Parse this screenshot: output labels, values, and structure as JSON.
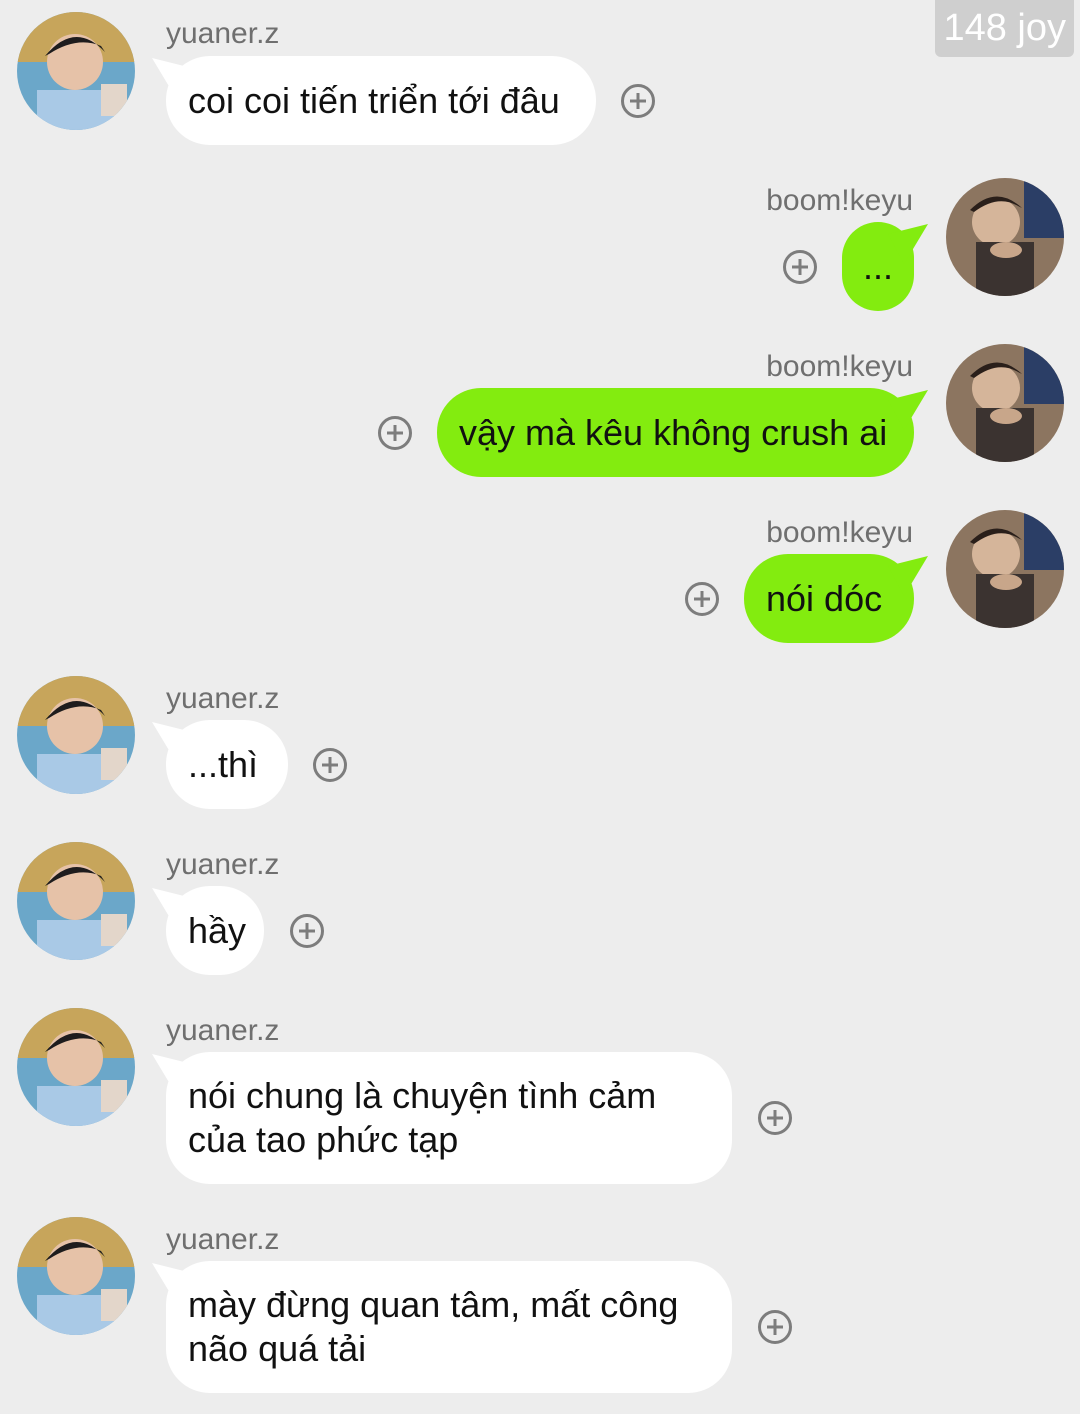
{
  "corner_badge": "148 joy",
  "messages": [
    {
      "sender": "yuaner.z",
      "text": "coi coi tiến triển tới đâu"
    },
    {
      "sender": "boom!keyu",
      "text": "..."
    },
    {
      "sender": "boom!keyu",
      "text": "vậy mà kêu không crush ai"
    },
    {
      "sender": "boom!keyu",
      "text": "nói dóc"
    },
    {
      "sender": "yuaner.z",
      "text": "...thì"
    },
    {
      "sender": "yuaner.z",
      "text": "hầy"
    },
    {
      "sender": "yuaner.z",
      "text": "nói chung là chuyện tình cảm\ncủa tao phức tạp"
    },
    {
      "sender": "yuaner.z",
      "text": "mày đừng quan tâm, mất công\nnão quá tải"
    }
  ],
  "avatar_icons": {
    "incoming": "avatar-yuaner",
    "outgoing": "avatar-keyu"
  },
  "colors": {
    "background": "#ededed",
    "incoming_bubble": "#ffffff",
    "outgoing_bubble": "#83ec0f",
    "icon": "#7d7d7d"
  }
}
